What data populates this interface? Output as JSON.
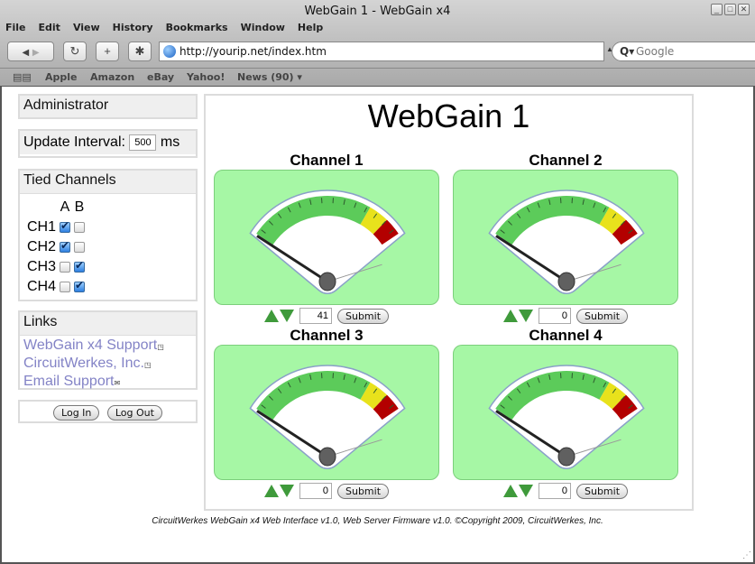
{
  "window": {
    "title": "WebGain 1 - WebGain x4",
    "controls": [
      "minimize",
      "maximize",
      "close"
    ]
  },
  "menu": [
    "File",
    "Edit",
    "View",
    "History",
    "Bookmarks",
    "Window",
    "Help"
  ],
  "toolbar": {
    "back_icon": "◀",
    "forward_icon": "▶",
    "reload_icon": "↻",
    "add_icon": "+",
    "bug_icon": "✱",
    "url": "http://yourip.net/index.htm",
    "search_placeholder": "Google",
    "search_icon": "Q▾"
  },
  "bookmarks": {
    "book_icon": "📖",
    "items": [
      "Apple",
      "Amazon",
      "eBay",
      "Yahoo!",
      "News (90) ▾"
    ]
  },
  "sidebar": {
    "admin_title": "Administrator",
    "update_label": "Update Interval:",
    "update_value": "500",
    "update_unit": "ms",
    "tied_title": "Tied Channels",
    "col_a": "A",
    "col_b": "B",
    "tied_rows": [
      {
        "label": "CH1",
        "a": true,
        "b": false
      },
      {
        "label": "CH2",
        "a": true,
        "b": false
      },
      {
        "label": "CH3",
        "a": false,
        "b": true
      },
      {
        "label": "CH4",
        "a": false,
        "b": true
      }
    ],
    "links_title": "Links",
    "links": [
      {
        "label": "WebGain x4 Support",
        "icon": "external-link-icon"
      },
      {
        "label": "CircuitWerkes, Inc.",
        "icon": "external-link-icon"
      },
      {
        "label": "Email Support",
        "icon": "email-icon"
      }
    ],
    "login_label": "Log In",
    "logout_label": "Log Out"
  },
  "main": {
    "title": "WebGain 1",
    "submit_label": "Submit",
    "channels": [
      {
        "title": "Channel 1",
        "value": "41"
      },
      {
        "title": "Channel 2",
        "value": "0"
      },
      {
        "title": "Channel 3",
        "value": "0"
      },
      {
        "title": "Channel 4",
        "value": "0"
      }
    ],
    "gauge_colors": {
      "green": "#5ccb5a",
      "yellow": "#e8e21c",
      "red": "#b30000",
      "panel": "#a6f7a5"
    }
  },
  "footer": "CircuitWerkes WebGain x4 Web Interface v1.0, Web Server Firmware v1.0. ©Copyright 2009, CircuitWerkes, Inc."
}
